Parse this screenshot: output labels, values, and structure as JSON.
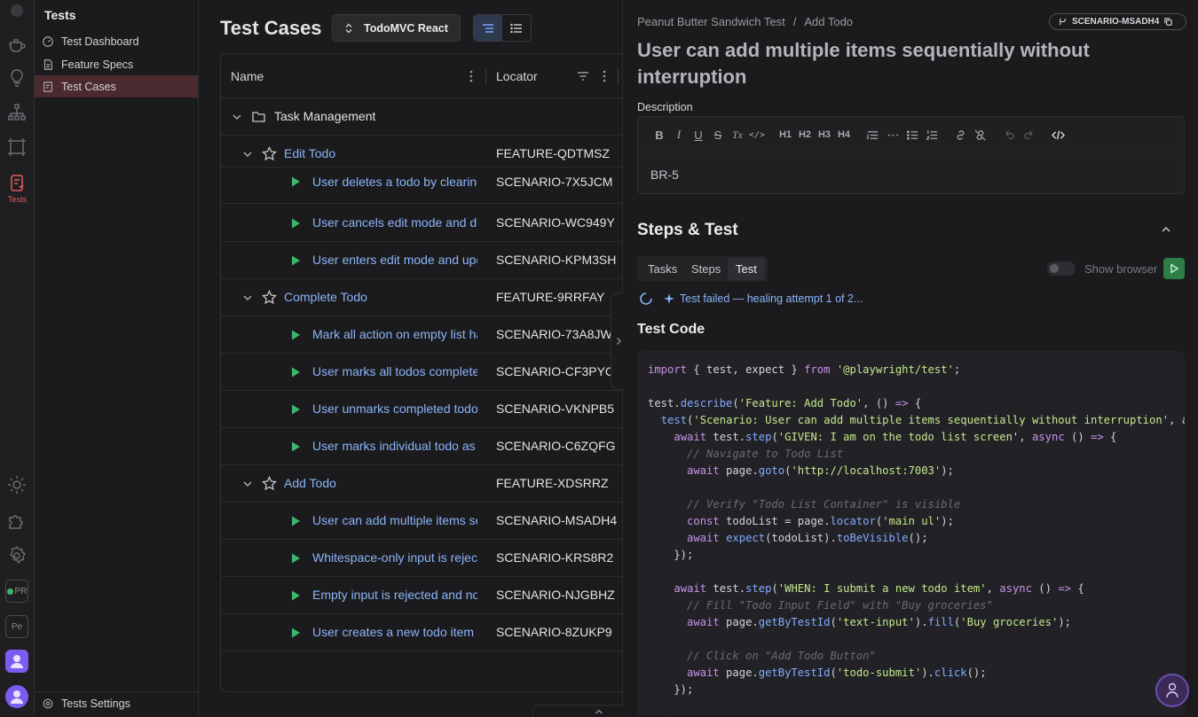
{
  "activity_bar": {
    "tests_label": "Tests",
    "badges": [
      "PR",
      "Pe"
    ],
    "icons": [
      "teapot-icon",
      "lightbulb-icon",
      "hierarchy-icon",
      "frame-icon",
      "tests-icon",
      "sun-icon",
      "puzzle-icon",
      "gear-icon",
      "pr-badge-icon",
      "project-badge-icon",
      "team-avatar-icon",
      "user-avatar-icon"
    ]
  },
  "sidebar": {
    "title": "Tests",
    "items": [
      {
        "label": "Test Dashboard",
        "icon": "dashboard-icon"
      },
      {
        "label": "Feature Specs",
        "icon": "document-icon"
      },
      {
        "label": "Test Cases",
        "icon": "checklist-icon",
        "active": true
      }
    ],
    "settings_label": "Tests Settings"
  },
  "middle": {
    "title": "Test Cases",
    "project_select": "TodoMVC React",
    "columns": {
      "name": "Name",
      "locator": "Locator"
    },
    "group": "Task Management",
    "features": [
      {
        "name": "Edit Todo",
        "locator": "FEATURE-QDTMSZ",
        "scenarios": [
          {
            "name": "User deletes a todo by clearing",
            "locator": "SCENARIO-7X5JCM"
          },
          {
            "name": "User cancels edit mode and discards",
            "locator": "SCENARIO-WC949Y"
          },
          {
            "name": "User enters edit mode and updates",
            "locator": "SCENARIO-KPM3SH"
          }
        ]
      },
      {
        "name": "Complete Todo",
        "locator": "FEATURE-9RRFAY",
        "scenarios": [
          {
            "name": "Mark all action on empty list has",
            "locator": "SCENARIO-73A8JW"
          },
          {
            "name": "User marks all todos complete",
            "locator": "SCENARIO-CF3PYC"
          },
          {
            "name": "User unmarks completed todo",
            "locator": "SCENARIO-VKNPB5"
          },
          {
            "name": "User marks individual todo as",
            "locator": "SCENARIO-C6ZQFG"
          }
        ]
      },
      {
        "name": "Add Todo",
        "locator": "FEATURE-XDSRRZ",
        "scenarios": [
          {
            "name": "User can add multiple items sequentially",
            "locator": "SCENARIO-MSADH4"
          },
          {
            "name": "Whitespace-only input is rejected",
            "locator": "SCENARIO-KRS8R2"
          },
          {
            "name": "Empty input is rejected and no",
            "locator": "SCENARIO-NJGBHZ"
          },
          {
            "name": "User creates a new todo item",
            "locator": "SCENARIO-8ZUKP9"
          }
        ]
      }
    ]
  },
  "detail": {
    "breadcrumb": [
      "Peanut Butter Sandwich Test",
      "Add Todo"
    ],
    "scenario_id": "SCENARIO-MSADH4",
    "title": "User can add multiple items sequentially without interruption",
    "description_label": "Description",
    "toolbar": [
      "B",
      "I",
      "U",
      "S",
      "Tx",
      "</>",
      "H1",
      "H2",
      "H3",
      "H4",
      "quote",
      "hr",
      "bullet-list",
      "ordered-list",
      "link",
      "unlink",
      "undo",
      "redo",
      "code-view"
    ],
    "description_text": "BR-5",
    "steps_title": "Steps & Test",
    "tabs": [
      "Tasks",
      "Steps",
      "Test"
    ],
    "active_tab": "Test",
    "show_browser_label": "Show browser",
    "status_text": "Test failed — healing attempt 1 of 2...",
    "code_title": "Test Code",
    "code_lines": [
      "import { test, expect } from '@playwright/test';",
      "",
      "test.describe('Feature: Add Todo', () => {",
      "  test('Scenario: User can add multiple items sequentially without interruption', asy",
      "    await test.step('GIVEN: I am on the todo list screen', async () => {",
      "      // Navigate to Todo List",
      "      await page.goto('http://localhost:7003');",
      "",
      "      // Verify \"Todo List Container\" is visible",
      "      const todoList = page.locator('main ul');",
      "      await expect(todoList).toBeVisible();",
      "    });",
      "",
      "    await test.step('WHEN: I submit a new todo item', async () => {",
      "      // Fill \"Todo Input Field\" with \"Buy groceries\"",
      "      await page.getByTestId('text-input').fill('Buy groceries');",
      "",
      "      // Click on \"Add Todo Button\"",
      "      await page.getByTestId('todo-submit').click();",
      "    });"
    ]
  },
  "colors": {
    "accent_link": "#8ab4f8",
    "active_sidebar": "#4a2a2f",
    "run_green": "#2e7d46",
    "play_green": "#3fb56b",
    "tests_red": "#e35b5b"
  }
}
